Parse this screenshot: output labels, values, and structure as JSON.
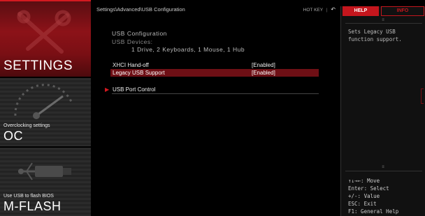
{
  "left_nav": {
    "settings": {
      "title": "SETTINGS"
    },
    "oc": {
      "subtitle": "Overclocking settings",
      "title": "OC"
    },
    "mflash": {
      "subtitle": "Use USB to flash BIOS",
      "title": "M-FLASH"
    }
  },
  "header": {
    "breadcrumb": "Settings\\Advanced\\USB Configuration",
    "hotkey_label": "HOT KEY",
    "hotkey_sep": "|",
    "back_icon": "↶"
  },
  "main": {
    "section_title": "USB Configuration",
    "devices_label": "USB Devices:",
    "devices_value": "1 Drive, 2 Keyboards, 1 Mouse, 1 Hub",
    "options": [
      {
        "label": "XHCI Hand-off",
        "value": "[Enabled]",
        "selected": false
      },
      {
        "label": "Legacy USB Support",
        "value": "[Enabled]",
        "selected": true
      }
    ],
    "submenu": {
      "arrow": "▶",
      "label": "USB Port Control"
    }
  },
  "help_panel": {
    "tab_help": "HELP",
    "tab_info": "INFO",
    "scroll_mark": "≡",
    "description": "Sets Legacy USB function support.",
    "keys": [
      "↑↓→←: Move",
      "Enter: Select",
      "+/-: Value",
      "ESC: Exit",
      "F1: General Help"
    ]
  },
  "colors": {
    "accent": "#c4161d",
    "selected_row": "#6e0f15",
    "background": "#000000"
  },
  "icons": [
    "settings-tools-icon",
    "oc-gauge-icon",
    "usb-flash-icon",
    "back-arrow-icon",
    "submenu-arrow-icon"
  ]
}
